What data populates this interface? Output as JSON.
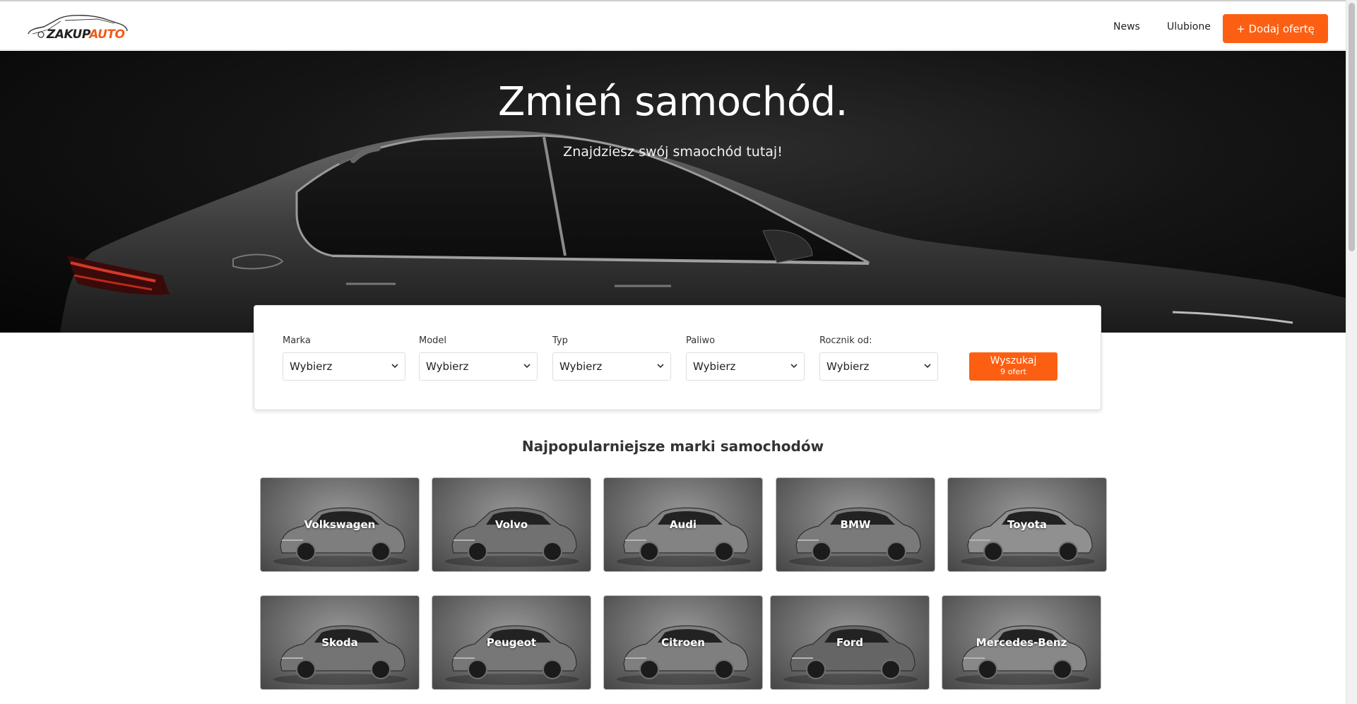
{
  "header": {
    "logo": {
      "part1": "ZAKUP",
      "part2": "AUTO"
    },
    "nav": [
      {
        "label": "News"
      },
      {
        "label": "Ulubione"
      }
    ],
    "add_button_label": "+ Dodaj ofertę"
  },
  "hero": {
    "title": "Zmień samochód.",
    "subtitle": "Znajdziesz swój smaochód tutaj!"
  },
  "search": {
    "fields": [
      {
        "label": "Marka",
        "value": "Wybierz"
      },
      {
        "label": "Model",
        "value": "Wybierz"
      },
      {
        "label": "Typ",
        "value": "Wybierz"
      },
      {
        "label": "Paliwo",
        "value": "Wybierz"
      },
      {
        "label": "Rocznik od:",
        "value": "Wybierz"
      }
    ],
    "button_label": "Wyszukaj",
    "button_count": "9 ofert"
  },
  "brands_title": "Najpopularniejsze marki samochodów",
  "brands": [
    {
      "name": "Volkswagen"
    },
    {
      "name": "Volvo"
    },
    {
      "name": "Audi"
    },
    {
      "name": "BMW"
    },
    {
      "name": "Toyota"
    },
    {
      "name": "Skoda"
    },
    {
      "name": "Peugeot"
    },
    {
      "name": "Citroen"
    },
    {
      "name": "Ford"
    },
    {
      "name": "Mercedes-Benz"
    }
  ],
  "colors": {
    "accent": "#fd5f12",
    "hero_bg": "#0b0b0b",
    "text": "#333333"
  }
}
